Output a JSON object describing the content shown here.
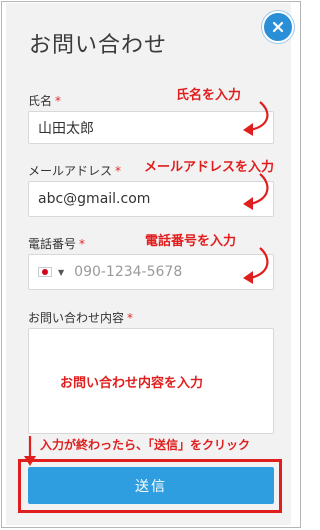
{
  "dialog": {
    "title": "お問い合わせ",
    "close_icon": "close-icon"
  },
  "form": {
    "required_mark": "*",
    "name": {
      "label": "氏名",
      "value": "山田太郎"
    },
    "email": {
      "label": "メールアドレス",
      "value": "abc@gmail.com"
    },
    "phone": {
      "label": "電話番号",
      "country_flag": "japan-flag-icon",
      "placeholder": "090-1234-5678"
    },
    "message": {
      "label": "お問い合わせ内容",
      "value": ""
    },
    "submit_label": "送信"
  },
  "annotations": {
    "name": "氏名を入力",
    "email": "メールアドレスを入力",
    "phone": "電話番号を入力",
    "message": "お問い合わせ内容を入力",
    "submit": "入力が終わったら、「送信」をクリック"
  },
  "colors": {
    "accent": "#2e9ee0",
    "annotation": "#e01e1e",
    "required": "#e02b2b"
  }
}
